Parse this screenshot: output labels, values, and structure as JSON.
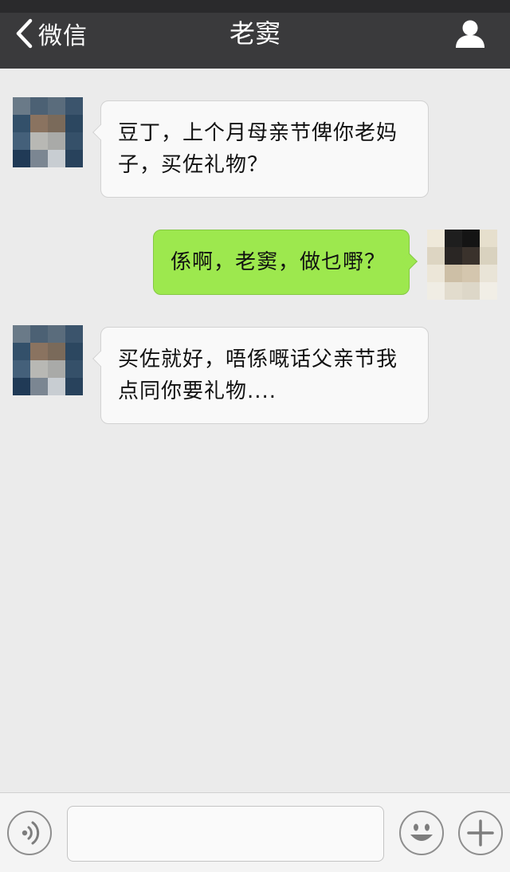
{
  "header": {
    "back_label": "微信",
    "title": "老窦"
  },
  "messages": [
    {
      "side": "left",
      "text": "豆丁，上个月母亲节俾你老妈子，买佐礼物？"
    },
    {
      "side": "right",
      "text": "係啊，老窦，做乜嘢？"
    },
    {
      "side": "left",
      "text": "买佐就好，唔係嘅话父亲节我点同你要礼物...."
    }
  ],
  "input": {
    "value": "",
    "placeholder": ""
  },
  "icons": {
    "back": "chevron-left-icon",
    "profile": "person-icon",
    "voice": "voice-icon",
    "emoji": "emoji-icon",
    "more": "plus-icon"
  },
  "colors": {
    "header_bg": "#3a3a3c",
    "chat_bg": "#ebebeb",
    "bubble_received": "#f9f9f9",
    "bubble_sent": "#9de84e"
  }
}
